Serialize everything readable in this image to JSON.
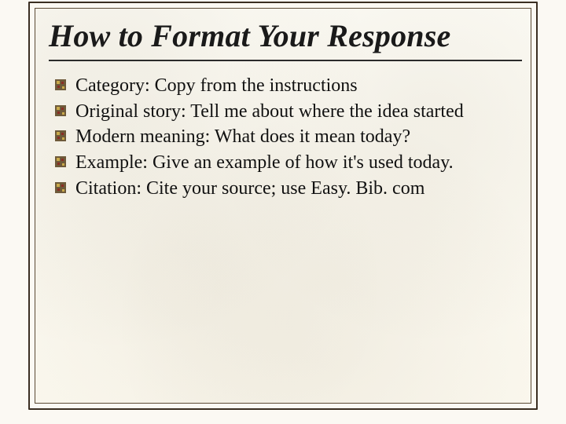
{
  "slide": {
    "title": "How to Format Your Response",
    "bullets": [
      "Category:  Copy from the instructions",
      "Original story:  Tell me about where the idea started",
      "Modern meaning:  What does it mean today?",
      "Example:  Give an example of how it's used today.",
      "Citation:  Cite your source; use Easy. Bib. com"
    ]
  }
}
